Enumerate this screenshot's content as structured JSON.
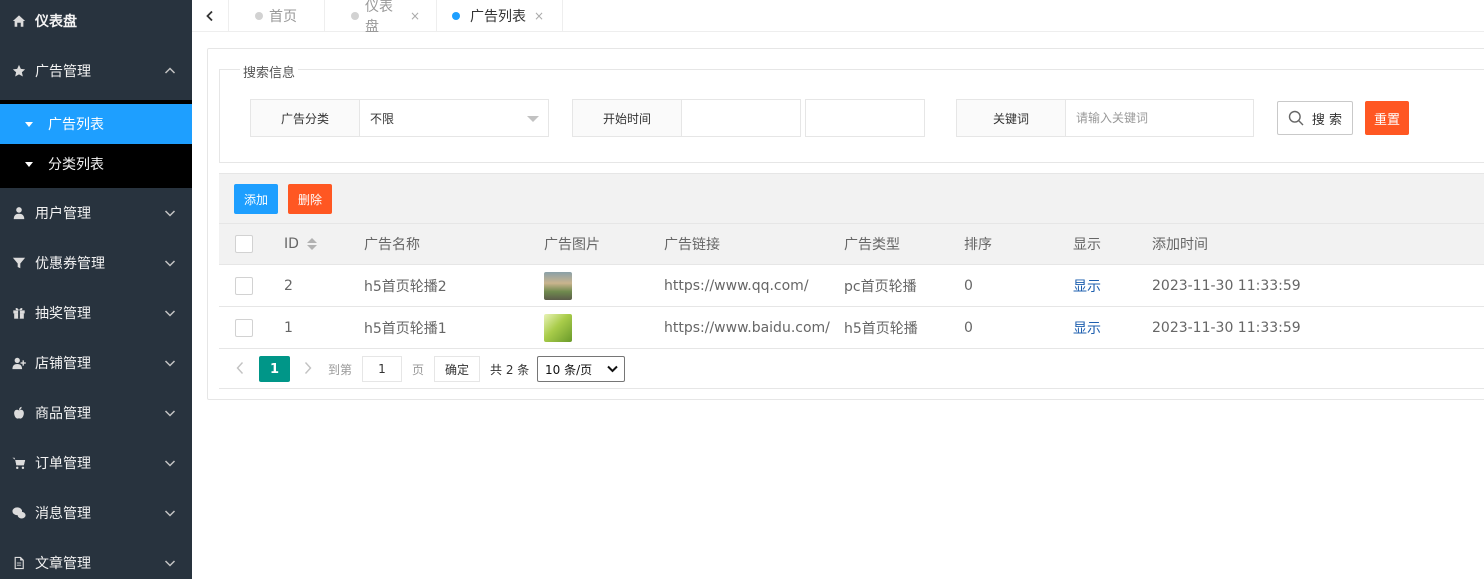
{
  "sidebar": {
    "brand": "仪表盘",
    "items": [
      {
        "label": "广告管理",
        "icon": "star-icon",
        "expanded": true
      },
      {
        "label": "用户管理",
        "icon": "user-icon"
      },
      {
        "label": "优惠券管理",
        "icon": "filter-icon"
      },
      {
        "label": "抽奖管理",
        "icon": "gift-icon"
      },
      {
        "label": "店铺管理",
        "icon": "user-plus-icon"
      },
      {
        "label": "商品管理",
        "icon": "apple-icon"
      },
      {
        "label": "订单管理",
        "icon": "cart-icon"
      },
      {
        "label": "消息管理",
        "icon": "wechat-icon"
      },
      {
        "label": "文章管理",
        "icon": "file-icon"
      }
    ],
    "sub_items": [
      {
        "label": "广告列表",
        "active": true
      },
      {
        "label": "分类列表"
      }
    ]
  },
  "tabs": [
    {
      "label": "首页",
      "closable": false
    },
    {
      "label": "仪表盘",
      "closable": true,
      "close": "×"
    },
    {
      "label": "广告列表",
      "closable": true,
      "active": true,
      "close": "×"
    }
  ],
  "search": {
    "legend": "搜索信息",
    "category_label": "广告分类",
    "category_value": "不限",
    "start_time_label": "开始时间",
    "keyword_label": "关键词",
    "keyword_placeholder": "请输入关键词",
    "search_button": "搜 索",
    "reset_button": "重置"
  },
  "toolbar": {
    "add_button": "添加",
    "delete_button": "删除"
  },
  "table": {
    "columns": [
      "ID",
      "广告名称",
      "广告图片",
      "广告链接",
      "广告类型",
      "排序",
      "显示",
      "添加时间"
    ],
    "rows": [
      {
        "id": "2",
        "name": "h5首页轮播2",
        "link": "https://www.qq.com/",
        "type": "pc首页轮播",
        "sort": "0",
        "show": "显示",
        "time": "2023-11-30 11:33:59"
      },
      {
        "id": "1",
        "name": "h5首页轮播1",
        "link": "https://www.baidu.com/",
        "type": "h5首页轮播",
        "sort": "0",
        "show": "显示",
        "time": "2023-11-30 11:33:59"
      }
    ]
  },
  "pager": {
    "current": "1",
    "goto_label": "到第",
    "goto_value": "1",
    "page_unit": "页",
    "confirm": "确定",
    "total": "共 2 条",
    "page_size": "10 条/页"
  },
  "colors": {
    "sidebar_bg": "#28333e",
    "active_blue": "#1e9fff",
    "danger": "#ff5722",
    "pager_green": "#009688"
  }
}
